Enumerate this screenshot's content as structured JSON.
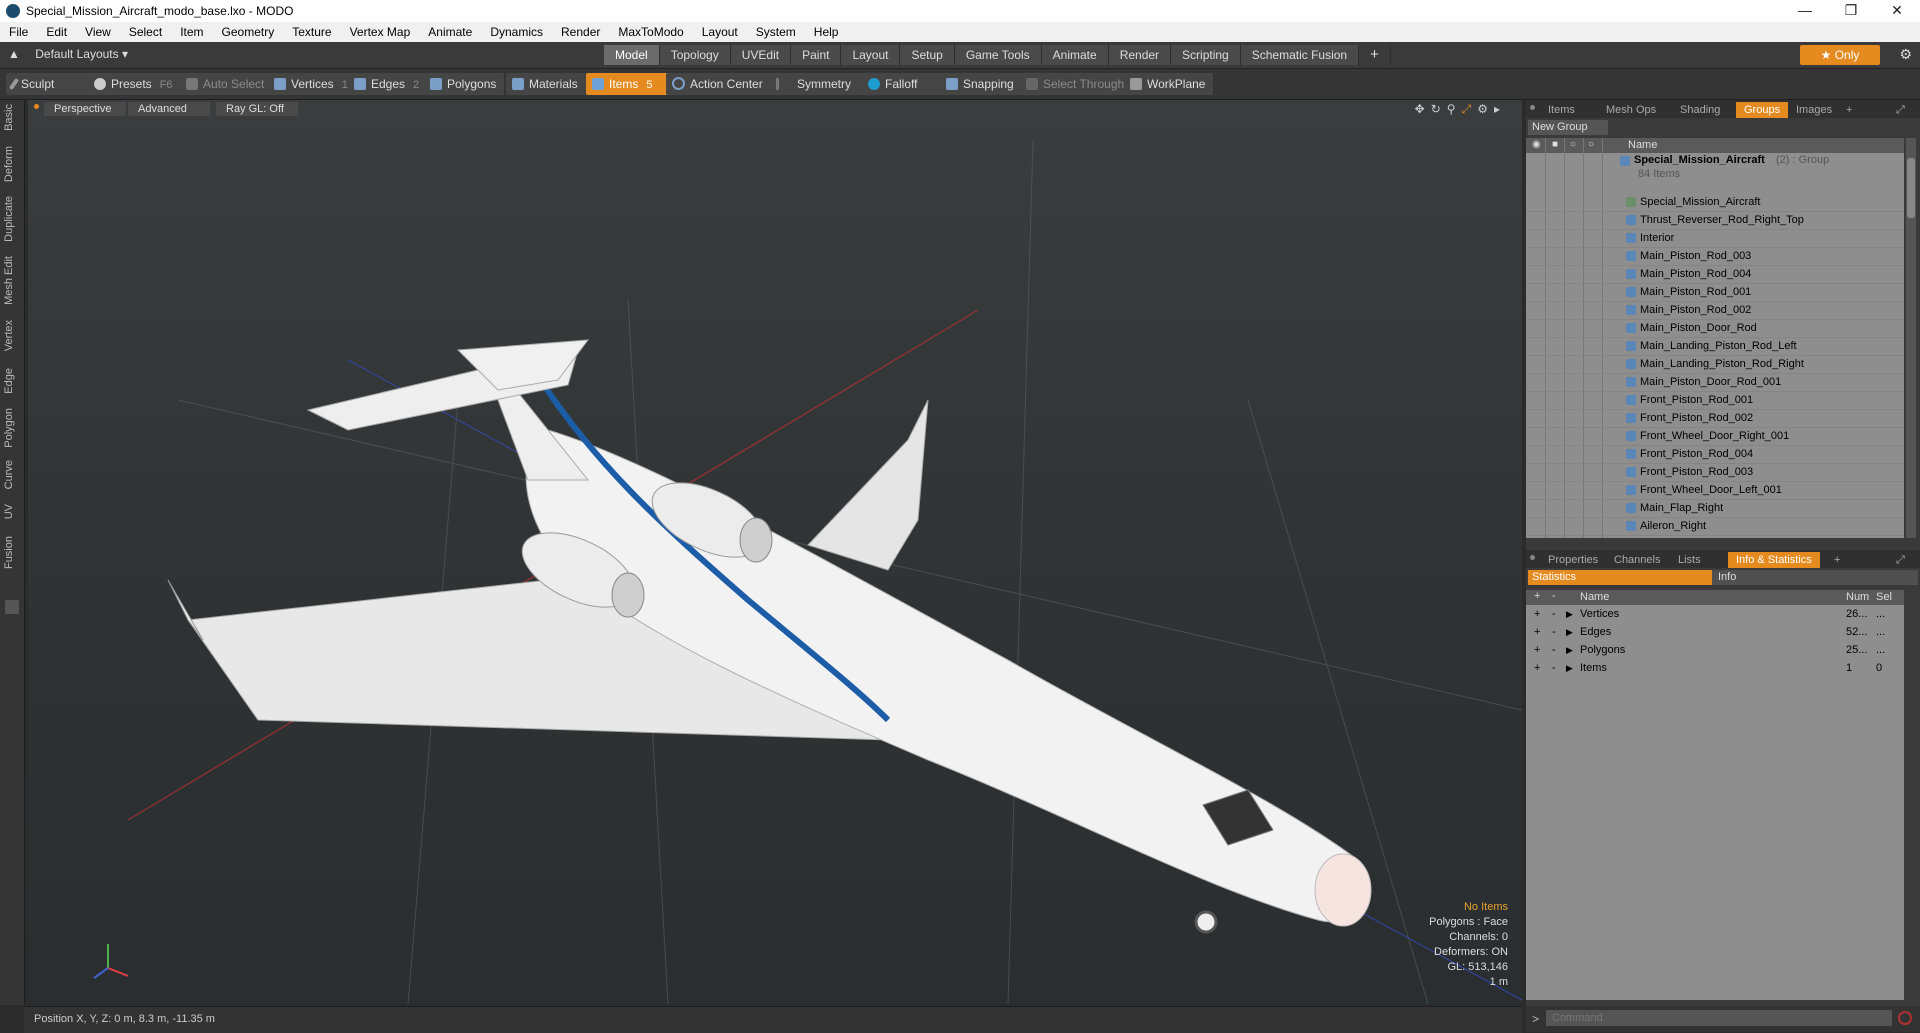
{
  "window": {
    "title": "Special_Mission_Aircraft_modo_base.lxo - MODO"
  },
  "menu": [
    "File",
    "Edit",
    "View",
    "Select",
    "Item",
    "Geometry",
    "Texture",
    "Vertex Map",
    "Animate",
    "Dynamics",
    "Render",
    "MaxToModo",
    "Layout",
    "System",
    "Help"
  ],
  "layout": {
    "default_label": "Default Layouts",
    "tabs": [
      "Model",
      "Topology",
      "UVEdit",
      "Paint",
      "Layout",
      "Setup",
      "Game Tools",
      "Animate",
      "Render",
      "Scripting",
      "Schematic Fusion"
    ],
    "active_tab": "Model",
    "only_label": "Only"
  },
  "toolbar": {
    "sculpt": "Sculpt",
    "presets": "Presets",
    "presets_key": "F6",
    "auto_select": "Auto Select",
    "vertices": "Vertices",
    "vertices_key": "1",
    "edges": "Edges",
    "edges_key": "2",
    "polygons": "Polygons",
    "materials": "Materials",
    "items": "Items",
    "items_key": "5",
    "action_center": "Action Center",
    "symmetry": "Symmetry",
    "falloff": "Falloff",
    "snapping": "Snapping",
    "select_through": "Select Through",
    "workplane": "WorkPlane"
  },
  "left_tabs": [
    "Basic",
    "Deform",
    "Duplicate",
    "Mesh Edit",
    "Vertex",
    "Edge",
    "Polygon",
    "Curve",
    "UV",
    "Fusion"
  ],
  "viewport": {
    "perspective": "Perspective",
    "advanced": "Advanced",
    "raygl": "Ray GL: Off",
    "info": {
      "no_items": "No Items",
      "polygons": "Polygons : Face",
      "channels": "Channels: 0",
      "deformers": "Deformers: ON",
      "gl": "GL: 513,146",
      "scale": "1 m"
    }
  },
  "status": {
    "position": "Position X, Y, Z:  0 m, 8.3 m, -11.35 m"
  },
  "groups_panel": {
    "tabs": [
      "Items",
      "Mesh Ops",
      "Shading",
      "Groups",
      "Images"
    ],
    "active_tab": "Groups",
    "new_group": "New Group",
    "name_header": "Name",
    "group_name": "Special_Mission_Aircraft",
    "group_suffix": "(2) : Group",
    "group_count": "84 Items",
    "items": [
      "Special_Mission_Aircraft",
      "Thrust_Reverser_Rod_Right_Top",
      "Interior",
      "Main_Piston_Rod_003",
      "Main_Piston_Rod_004",
      "Main_Piston_Rod_001",
      "Main_Piston_Rod_002",
      "Main_Piston_Door_Rod",
      "Main_Landing_Piston_Rod_Left",
      "Main_Landing_Piston_Rod_Right",
      "Main_Piston_Door_Rod_001",
      "Front_Piston_Rod_001",
      "Front_Piston_Rod_002",
      "Front_Wheel_Door_Right_001",
      "Front_Piston_Rod_004",
      "Front_Piston_Rod_003",
      "Front_Wheel_Door_Left_001",
      "Main_Flap_Right",
      "Aileron_Right"
    ]
  },
  "stats_panel": {
    "tabs": [
      "Properties",
      "Channels",
      "Lists",
      "Info & Statistics"
    ],
    "active_tab": "Info & Statistics",
    "sub_statistics": "Statistics",
    "sub_info": "Info",
    "headers": {
      "name": "Name",
      "num": "Num",
      "sel": "Sel"
    },
    "rows": [
      {
        "name": "Vertices",
        "num": "26...",
        "sel": "..."
      },
      {
        "name": "Edges",
        "num": "52...",
        "sel": "..."
      },
      {
        "name": "Polygons",
        "num": "25...",
        "sel": "..."
      },
      {
        "name": "Items",
        "num": "1",
        "sel": "0"
      }
    ]
  },
  "command": {
    "placeholder": "Command"
  },
  "colors": {
    "accent": "#e58a1e",
    "background": "#2b2b2b",
    "panel": "#8e8e8e"
  }
}
